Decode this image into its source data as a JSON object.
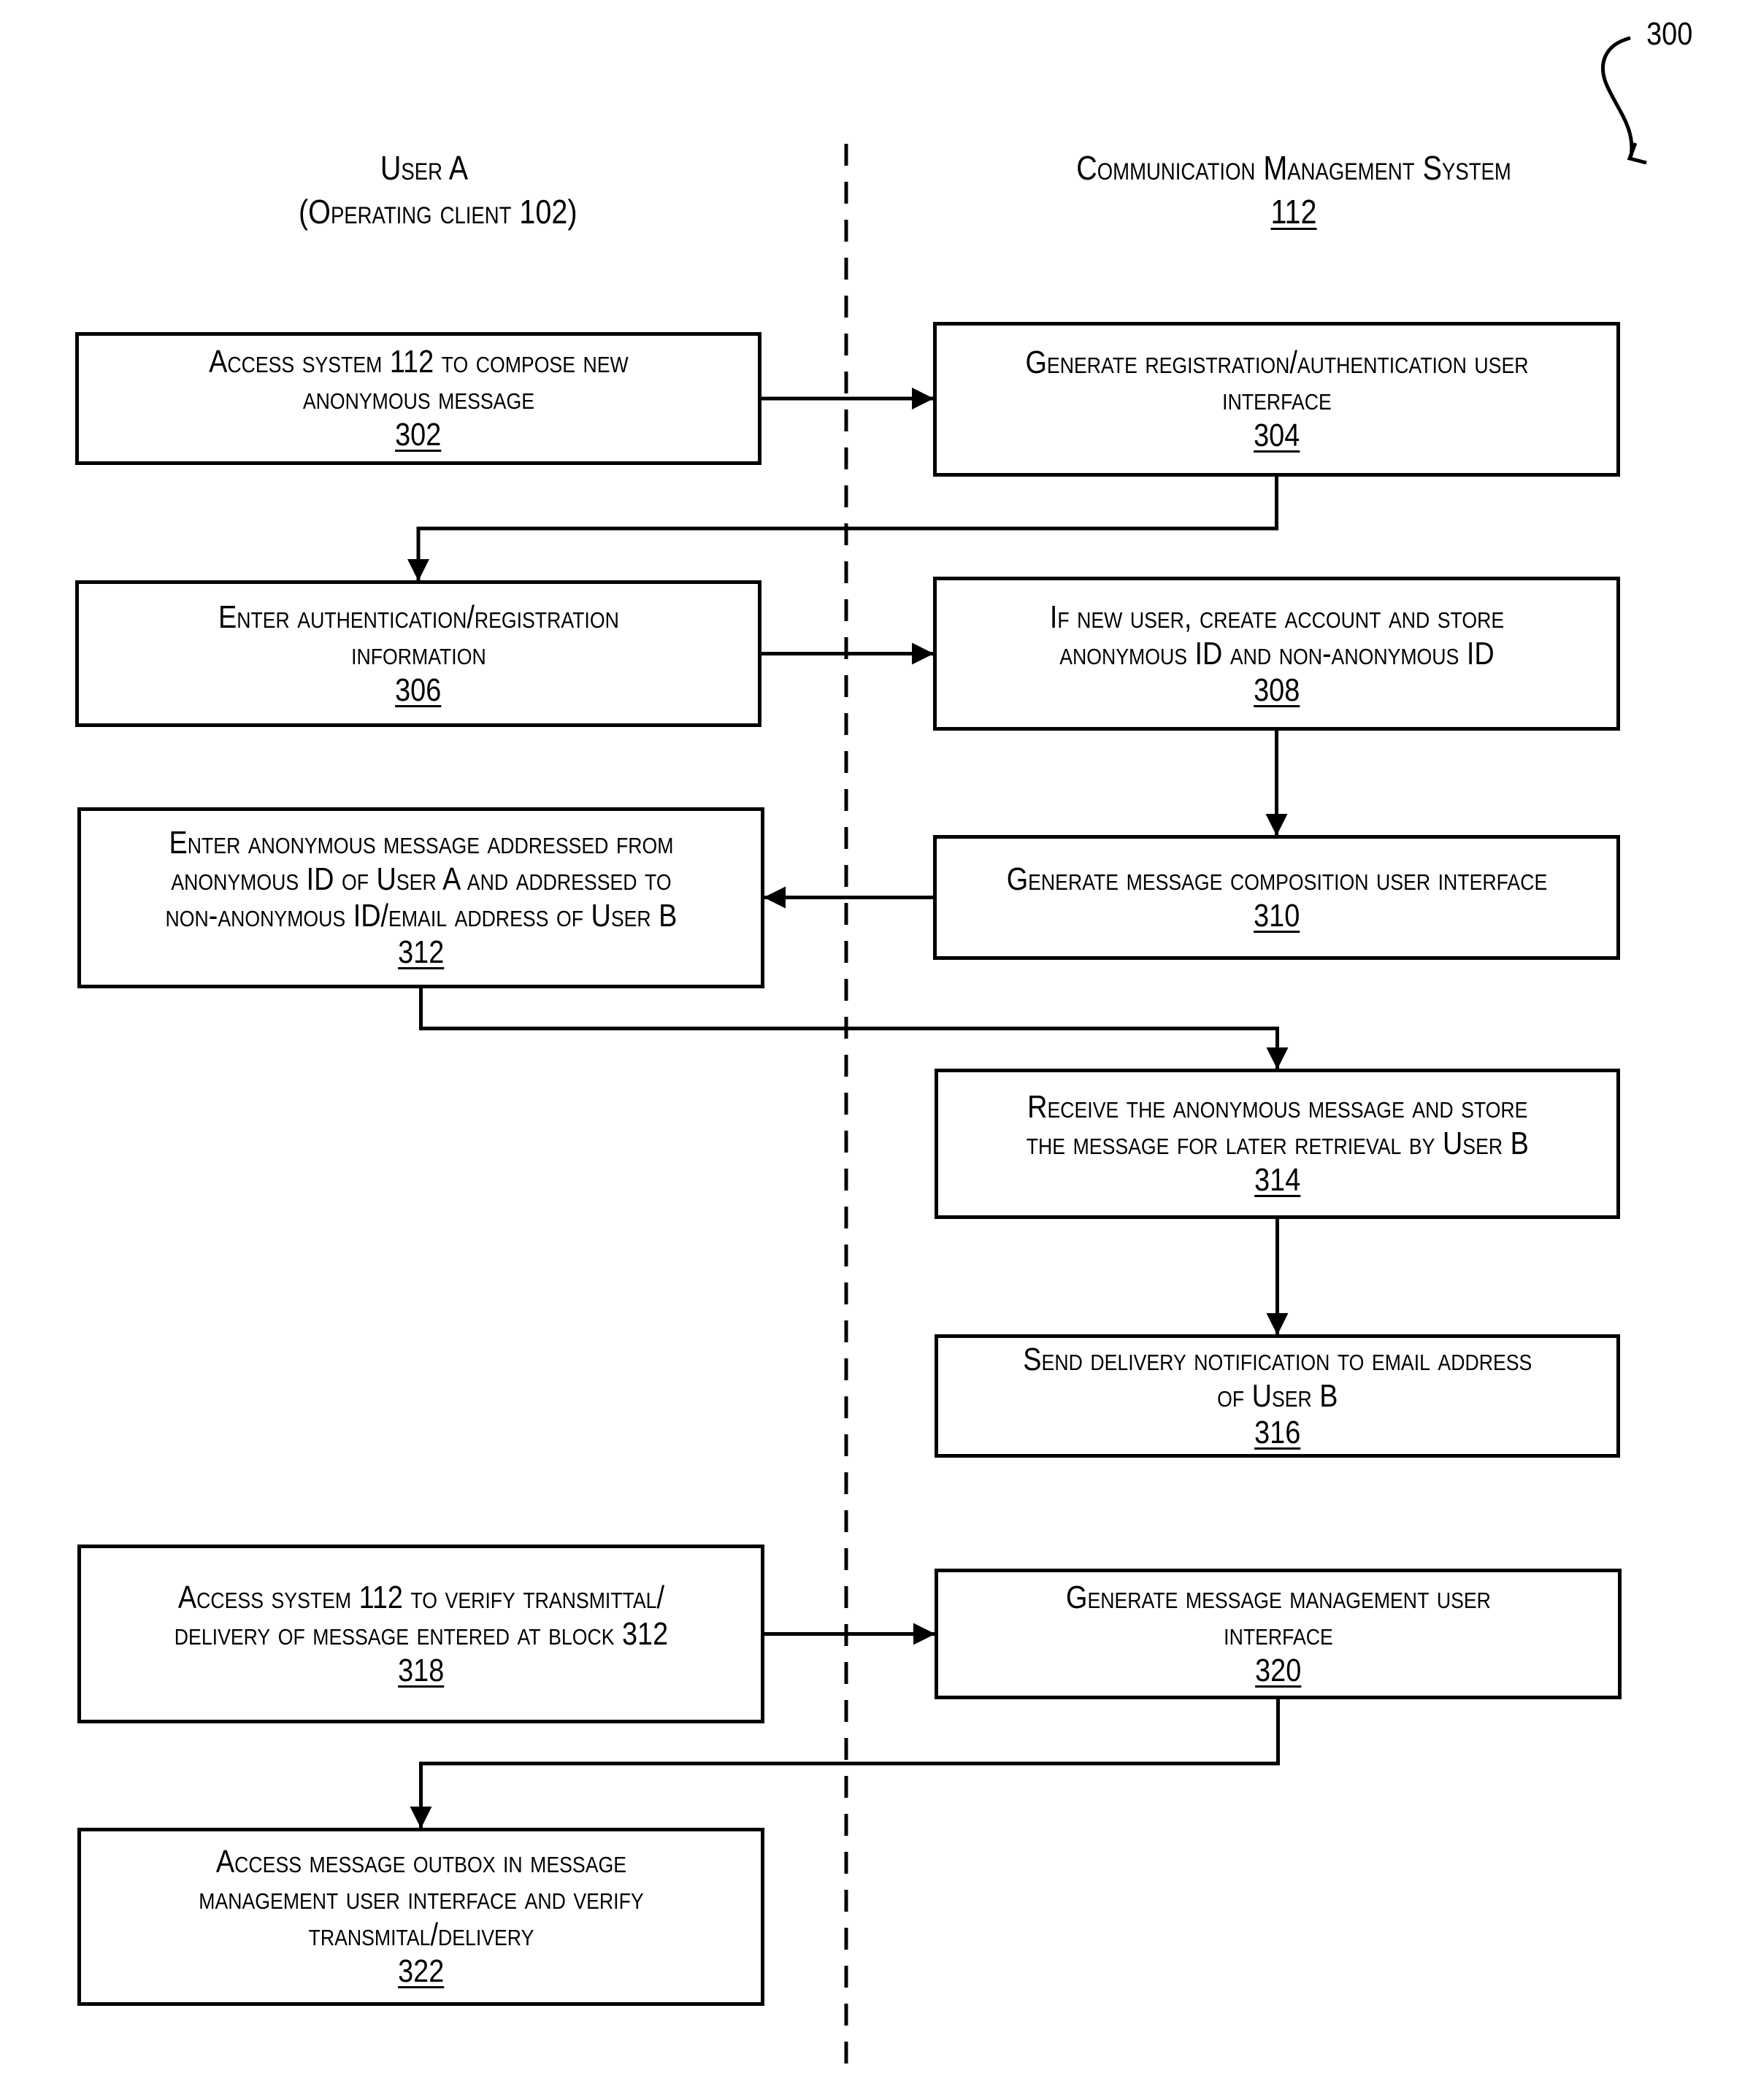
{
  "figure": {
    "label": "300"
  },
  "lanes": {
    "left": {
      "title": "User A",
      "subtitle": "(Operating client 102)"
    },
    "right": {
      "title": "Communication Management System",
      "ref": "112"
    }
  },
  "blocks": [
    {
      "id": "302",
      "lane": "left",
      "text": "Access system 112 to compose new\nanonymous message"
    },
    {
      "id": "304",
      "lane": "right",
      "text": "Generate registration/authentication user\ninterface"
    },
    {
      "id": "306",
      "lane": "left",
      "text": "Enter authentication/registration\ninformation"
    },
    {
      "id": "308",
      "lane": "right",
      "text": "If new user, create account and store\nanonymous ID and non-anonymous ID"
    },
    {
      "id": "310",
      "lane": "right",
      "text": "Generate message composition user interface"
    },
    {
      "id": "312",
      "lane": "left",
      "text": "Enter anonymous message addressed from\nanonymous ID of User A and addressed to\nnon-anonymous ID/email address of User B"
    },
    {
      "id": "314",
      "lane": "right",
      "text": "Receive the anonymous message and store\nthe message for later retrieval by User B"
    },
    {
      "id": "316",
      "lane": "right",
      "text": "Send delivery notification to email address\nof User B"
    },
    {
      "id": "318",
      "lane": "left",
      "text": "Access system 112 to verify transmittal/\ndelivery of message entered at block 312"
    },
    {
      "id": "320",
      "lane": "right",
      "text": "Generate message management user\ninterface"
    },
    {
      "id": "322",
      "lane": "left",
      "text": "Access message outbox in message\nmanagement user interface and verify\ntransmital/delivery"
    }
  ],
  "edges": [
    {
      "from": "302",
      "to": "304"
    },
    {
      "from": "304",
      "to": "306"
    },
    {
      "from": "306",
      "to": "308"
    },
    {
      "from": "308",
      "to": "310"
    },
    {
      "from": "310",
      "to": "312"
    },
    {
      "from": "312",
      "to": "314"
    },
    {
      "from": "314",
      "to": "316"
    },
    {
      "from": "318",
      "to": "320"
    },
    {
      "from": "320",
      "to": "322"
    }
  ]
}
